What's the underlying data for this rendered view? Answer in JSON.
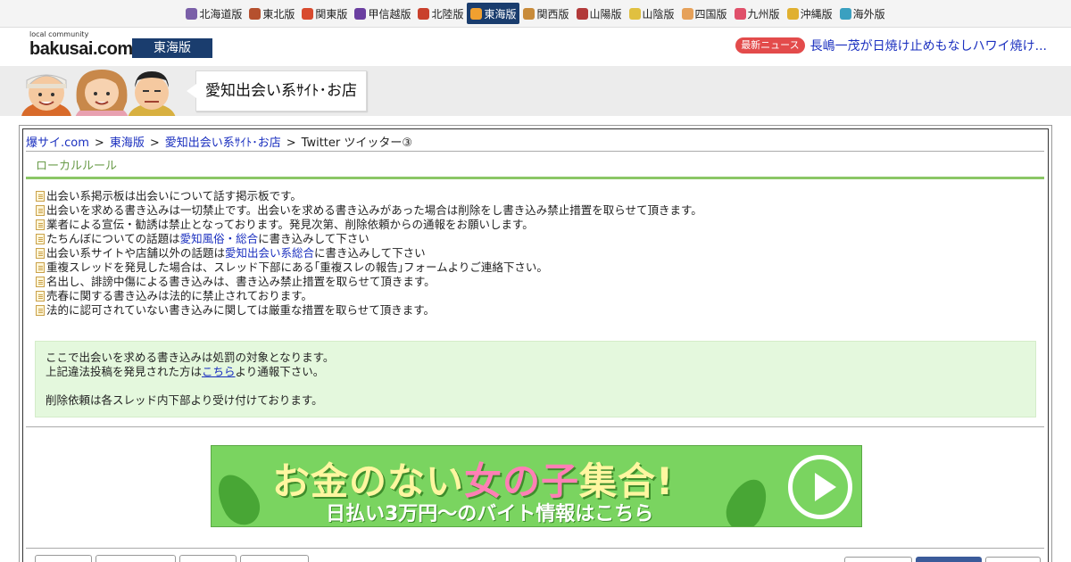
{
  "topnav": {
    "items": [
      {
        "label": "北海道版",
        "icon": "hokkaido-icon",
        "color": "#7a5fa8"
      },
      {
        "label": "東北版",
        "icon": "tohoku-icon",
        "color": "#b5502e"
      },
      {
        "label": "関東版",
        "icon": "tower-icon",
        "color": "#d84a2e"
      },
      {
        "label": "甲信越版",
        "icon": "grape-icon",
        "color": "#6a3fa0"
      },
      {
        "label": "北陸版",
        "icon": "torii-icon",
        "color": "#c9402c"
      },
      {
        "label": "東海版",
        "icon": "wave-icon",
        "color": "#f0a030",
        "active": true
      },
      {
        "label": "関西版",
        "icon": "takoyaki-icon",
        "color": "#c88b3a"
      },
      {
        "label": "山陽版",
        "icon": "castle-icon",
        "color": "#b23a3a"
      },
      {
        "label": "山陰版",
        "icon": "moon-icon",
        "color": "#e0c040"
      },
      {
        "label": "四国版",
        "icon": "udon-icon",
        "color": "#e6a15a"
      },
      {
        "label": "九州版",
        "icon": "fish-icon",
        "color": "#e0506a"
      },
      {
        "label": "沖縄版",
        "icon": "shisa-icon",
        "color": "#e0b030"
      },
      {
        "label": "海外版",
        "icon": "globe-icon",
        "color": "#3aa0c0"
      }
    ]
  },
  "header": {
    "logo_small": "local community",
    "logo_big": "bakusai.com",
    "edition": "東海版",
    "news_badge": "最新ニュース",
    "news_text": "長嶋一茂が日焼け止めもなしハワイ焼け..."
  },
  "board": {
    "title": "愛知出会い系ｻｲﾄ･お店"
  },
  "breadcrumb": {
    "items": [
      "爆サイ.com",
      "東海版",
      "愛知出会い系ｻｲﾄ･お店",
      "Twitter ツイッター③"
    ],
    "separator": ">"
  },
  "local_rule": {
    "title": "ローカルルール",
    "rules": [
      {
        "pre": "出会い系掲示板は出会いについて話す掲示板です。",
        "link": "",
        "post": ""
      },
      {
        "pre": "出会いを求める書き込みは一切禁止です。出会いを求める書き込みがあった場合は削除をし書き込み禁止措置を取らせて頂きます。",
        "link": "",
        "post": ""
      },
      {
        "pre": "業者による宣伝・勧誘は禁止となっております。発見次第、削除依頼からの通報をお願いします。",
        "link": "",
        "post": ""
      },
      {
        "pre": "たちんぼについての話題は",
        "link": "愛知風俗・総合",
        "post": "に書き込みして下さい"
      },
      {
        "pre": "出会い系サイトや店舗以外の話題は",
        "link": "愛知出会い系総合",
        "post": "に書き込みして下さい"
      },
      {
        "pre": "重複スレッドを発見した場合は、スレッド下部にある｢重複スレの報告｣フォームよりご連絡下さい。",
        "link": "",
        "post": ""
      },
      {
        "pre": "名出し、誹謗中傷による書き込みは、書き込み禁止措置を取らせて頂きます。",
        "link": "",
        "post": ""
      },
      {
        "pre": "売春に関する書き込みは法的に禁止されております。",
        "link": "",
        "post": ""
      },
      {
        "pre": "法的に認可されていない書き込みに関しては厳重な措置を取らせて頂きます。",
        "link": "",
        "post": ""
      }
    ]
  },
  "notice": {
    "line1": "ここで出会いを求める書き込みは処罰の対象となります。",
    "line2_pre": "上記違法投稿を発見された方は",
    "line2_link": "こちら",
    "line2_post": "より通報下さい。",
    "line3": "削除依頼は各スレッド内下部より受け付けております。"
  },
  "ad": {
    "line1_a": "お金のない",
    "line1_b": "女の子",
    "line1_c": "集合!",
    "line2": "日払い3万円〜のバイト情報はこちら"
  }
}
